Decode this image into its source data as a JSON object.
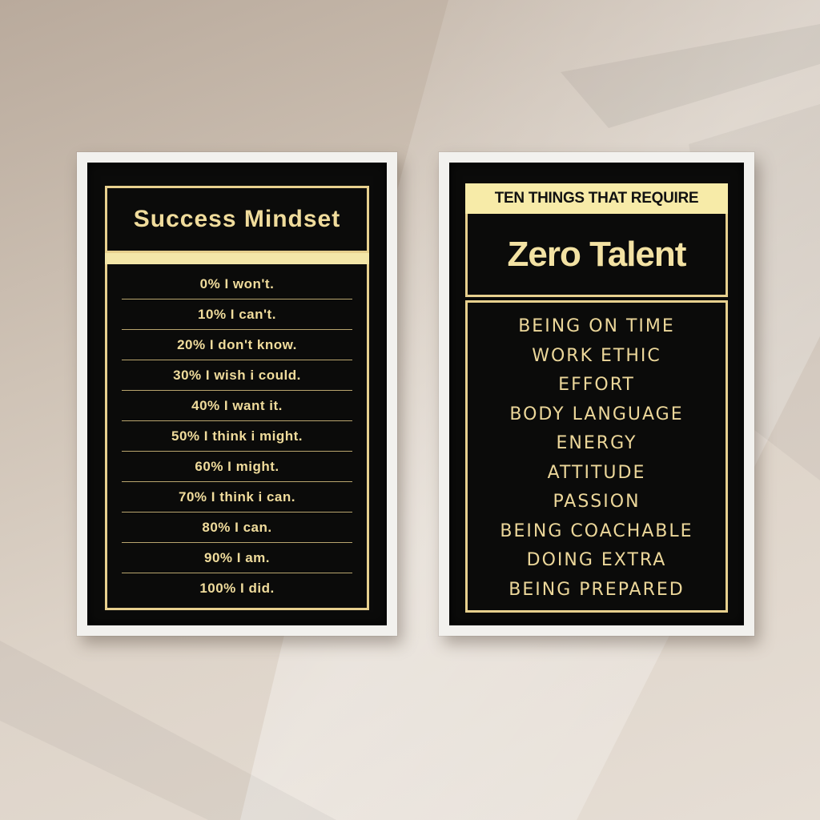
{
  "scene": {
    "wall_color": "#d8cdc1",
    "frame_color": "#f2f1ee",
    "poster_color": "#0b0b0a",
    "accent_gold": "#f0dc9c"
  },
  "left_poster": {
    "title": "Success Mindset",
    "items": [
      "0% I won't.",
      "10% I can't.",
      "20% I don't know.",
      "30% I wish i could.",
      "40% I want it.",
      "50% I think i might.",
      "60% I might.",
      "70% I think i can.",
      "80% I can.",
      "90% I am.",
      "100% I did."
    ]
  },
  "right_poster": {
    "subtitle": "TEN THINGS THAT REQUIRE",
    "title": "Zero Talent",
    "items": [
      "BEING ON TIME",
      "WORK ETHIC",
      "EFFORT",
      "BODY LANGUAGE",
      "ENERGY",
      "ATTITUDE",
      "PASSION",
      "BEING COACHABLE",
      "DOING EXTRA",
      "BEING PREPARED"
    ]
  }
}
